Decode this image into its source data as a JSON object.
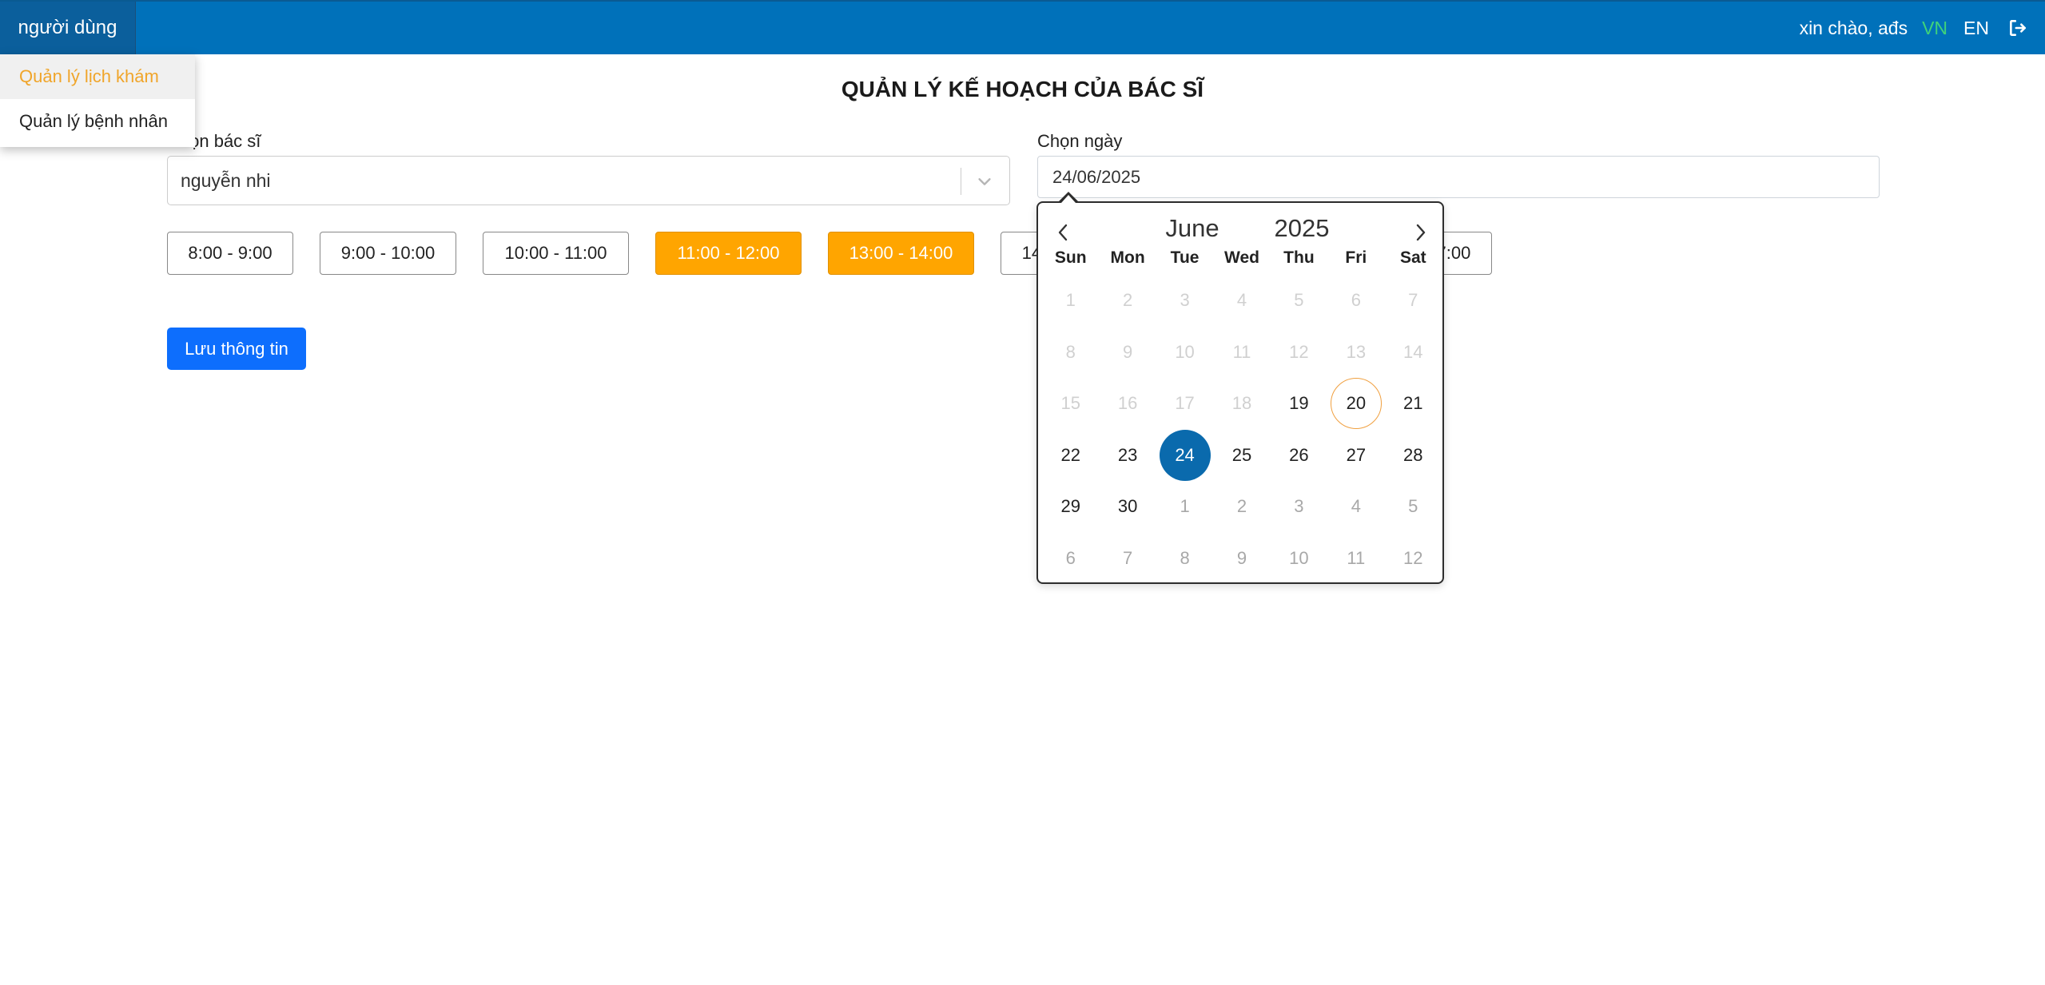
{
  "header": {
    "menu_label": "người dùng",
    "welcome": "xin chào, ađs",
    "lang_vn": "VN",
    "lang_en": "EN",
    "colors": {
      "bar": "#0071ba",
      "active_lang": "#3fd27a"
    }
  },
  "dropdown": {
    "items": [
      {
        "label": "Quản lý lịch khám",
        "active": true
      },
      {
        "label": "Quản lý bệnh nhân",
        "active": false
      }
    ]
  },
  "page": {
    "title": "QUẢN LÝ KẾ HOẠCH CỦA BÁC SĨ",
    "doctor_label": "Chọn bác sĩ",
    "doctor_value": "nguyễn nhi",
    "date_label": "Chọn ngày",
    "date_value": "24/06/2025",
    "save_label": "Lưu thông tin"
  },
  "time_slots": [
    {
      "label": "8:00 - 9:00",
      "selected": false
    },
    {
      "label": "9:00 - 10:00",
      "selected": false
    },
    {
      "label": "10:00 - 11:00",
      "selected": false
    },
    {
      "label": "11:00 - 12:00",
      "selected": true
    },
    {
      "label": "13:00 - 14:00",
      "selected": true
    },
    {
      "label": "14:00 - 15:00",
      "selected": false
    },
    {
      "label": "16:00 - 17:00",
      "selected": false
    }
  ],
  "calendar": {
    "month": "June",
    "year": "2025",
    "weekdays": [
      "Sun",
      "Mon",
      "Tue",
      "Wed",
      "Thu",
      "Fri",
      "Sat"
    ],
    "days": [
      {
        "d": "1",
        "state": "disabled"
      },
      {
        "d": "2",
        "state": "disabled"
      },
      {
        "d": "3",
        "state": "disabled"
      },
      {
        "d": "4",
        "state": "disabled"
      },
      {
        "d": "5",
        "state": "disabled"
      },
      {
        "d": "6",
        "state": "disabled"
      },
      {
        "d": "7",
        "state": "disabled"
      },
      {
        "d": "8",
        "state": "disabled"
      },
      {
        "d": "9",
        "state": "disabled"
      },
      {
        "d": "10",
        "state": "disabled"
      },
      {
        "d": "11",
        "state": "disabled"
      },
      {
        "d": "12",
        "state": "disabled"
      },
      {
        "d": "13",
        "state": "disabled"
      },
      {
        "d": "14",
        "state": "disabled"
      },
      {
        "d": "15",
        "state": "disabled"
      },
      {
        "d": "16",
        "state": "disabled"
      },
      {
        "d": "17",
        "state": "disabled"
      },
      {
        "d": "18",
        "state": "disabled"
      },
      {
        "d": "19",
        "state": "normal"
      },
      {
        "d": "20",
        "state": "today"
      },
      {
        "d": "21",
        "state": "normal"
      },
      {
        "d": "22",
        "state": "normal"
      },
      {
        "d": "23",
        "state": "normal"
      },
      {
        "d": "24",
        "state": "selected"
      },
      {
        "d": "25",
        "state": "normal"
      },
      {
        "d": "26",
        "state": "normal"
      },
      {
        "d": "27",
        "state": "normal"
      },
      {
        "d": "28",
        "state": "normal"
      },
      {
        "d": "29",
        "state": "normal"
      },
      {
        "d": "30",
        "state": "normal"
      },
      {
        "d": "1",
        "state": "other"
      },
      {
        "d": "2",
        "state": "other"
      },
      {
        "d": "3",
        "state": "other"
      },
      {
        "d": "4",
        "state": "other"
      },
      {
        "d": "5",
        "state": "other"
      },
      {
        "d": "6",
        "state": "other"
      },
      {
        "d": "7",
        "state": "other"
      },
      {
        "d": "8",
        "state": "other"
      },
      {
        "d": "9",
        "state": "other"
      },
      {
        "d": "10",
        "state": "other"
      },
      {
        "d": "11",
        "state": "other"
      },
      {
        "d": "12",
        "state": "other"
      }
    ]
  }
}
